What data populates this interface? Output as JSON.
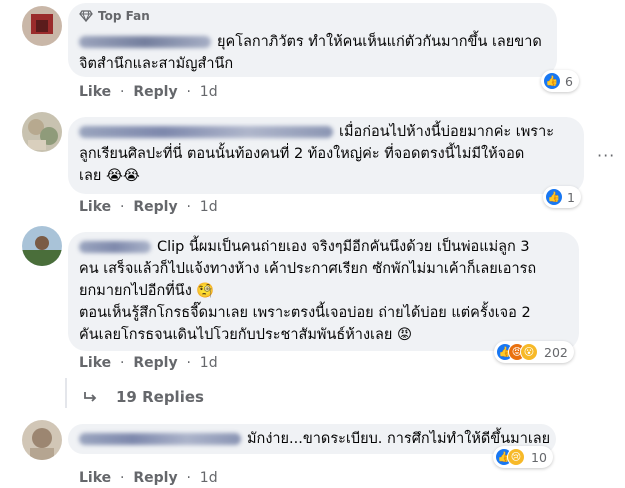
{
  "comments": [
    {
      "badge": "Top Fan",
      "text": "ยุคโลกาภิวัตร ทำให้คนเห็นแก่ตัวกันมากขึ้น เลยขาดจิตสำนึกและสามัญสำนึก",
      "line1": "ยุคโลกาภิวัตร ทำให้คนเห็นแก่ตัวกันมากขึ้น เลยขาด",
      "line2": "จิตสำนึกและสามัญสำนึก",
      "like": "Like",
      "reply": "Reply",
      "sep": "·",
      "age": "1d",
      "reaction_count": "6",
      "reactions": [
        "like"
      ]
    },
    {
      "text": "เมื่อก่อนไปห้างนี้บ่อยมากค่ะ เพราะลูกเรียนศิลปะที่นี่ ตอนนั้นท้องคนที่ 2 ท้องใหญ่ค่ะ ที่จอดตรงนี้ไม่มีให้จอดเลย 😭😭",
      "line1": "เมื่อก่อนไปห้างนี้บ่อยมากค่ะ เพราะ",
      "line2": "ลูกเรียนศิลปะที่นี่ ตอนนั้นท้องคนที่ 2 ท้องใหญ่ค่ะ ที่จอดตรงนี้ไม่มีให้จอด",
      "line3": "เลย 😭😭",
      "like": "Like",
      "reply": "Reply",
      "sep": "·",
      "age": "1d",
      "reaction_count": "1",
      "reactions": [
        "like"
      ]
    },
    {
      "text": "Clip นี้ผมเป็นคนถ่ายเอง จริงๆมีอีกคันนึงด้วย เป็นพ่อแม่ลูก 3 คน เสร็จแล้วก็ไปแจ้งทางห้าง เค้าประกาศเรียก ซักพักไม่มาเค้าก็เลยเอารถยกมายกไปอีกที่นึง 🧐 ตอนเห็นรู้สึกโกรธจี๊ดมาเลย เพราะตรงนี้เจอบ่อย ถ่ายได้บ่อย แต่ครั้งเจอ 2 คันเลยโกรธจนเดินไปโวยกับประชาสัมพันธ์ห้างเลย 😡",
      "line1": "Clip นี้ผมเป็นคนถ่ายเอง จริงๆมีอีกคันนึงด้วย เป็นพ่อแม่ลูก 3",
      "line2": "คน เสร็จแล้วก็ไปแจ้งทางห้าง เค้าประกาศเรียก ซักพักไม่มาเค้าก็เลยเอารถ",
      "line3": "ยกมายกไปอีกที่นึง 🧐",
      "line4": "ตอนเห็นรู้สึกโกรธจี๊ดมาเลย เพราะตรงนี้เจอบ่อย ถ่ายได้บ่อย แต่ครั้งเจอ 2",
      "line5": "คันเลยโกรธจนเดินไปโวยกับประชาสัมพันธ์ห้างเลย 😡",
      "like": "Like",
      "reply": "Reply",
      "sep": "·",
      "age": "1d",
      "reaction_count": "202",
      "reactions": [
        "like",
        "angry",
        "wow"
      ]
    },
    {
      "text": "มักง่าย...ขาดระเบียบ. การศึกไม่ทำให้ดีขึ้นมาเลย",
      "line1": "มักง่าย...ขาดระเบียบ. การศึกไม่ทำให้ดีขึ้นมาเลย",
      "like": "Like",
      "reply": "Reply",
      "sep": "·",
      "age": "1d",
      "reaction_count": "10",
      "reactions": [
        "like",
        "sad"
      ]
    }
  ],
  "replies_link": "19 Replies",
  "icons": {
    "badge": "diamond-icon",
    "more": "more-options-icon",
    "reply_arrow": "reply-arrow-icon",
    "like": "like-thumb-icon"
  },
  "colors": {
    "bubble": "#f0f2f5",
    "secondary_text": "#65676b",
    "like_blue": "#1877f2"
  }
}
